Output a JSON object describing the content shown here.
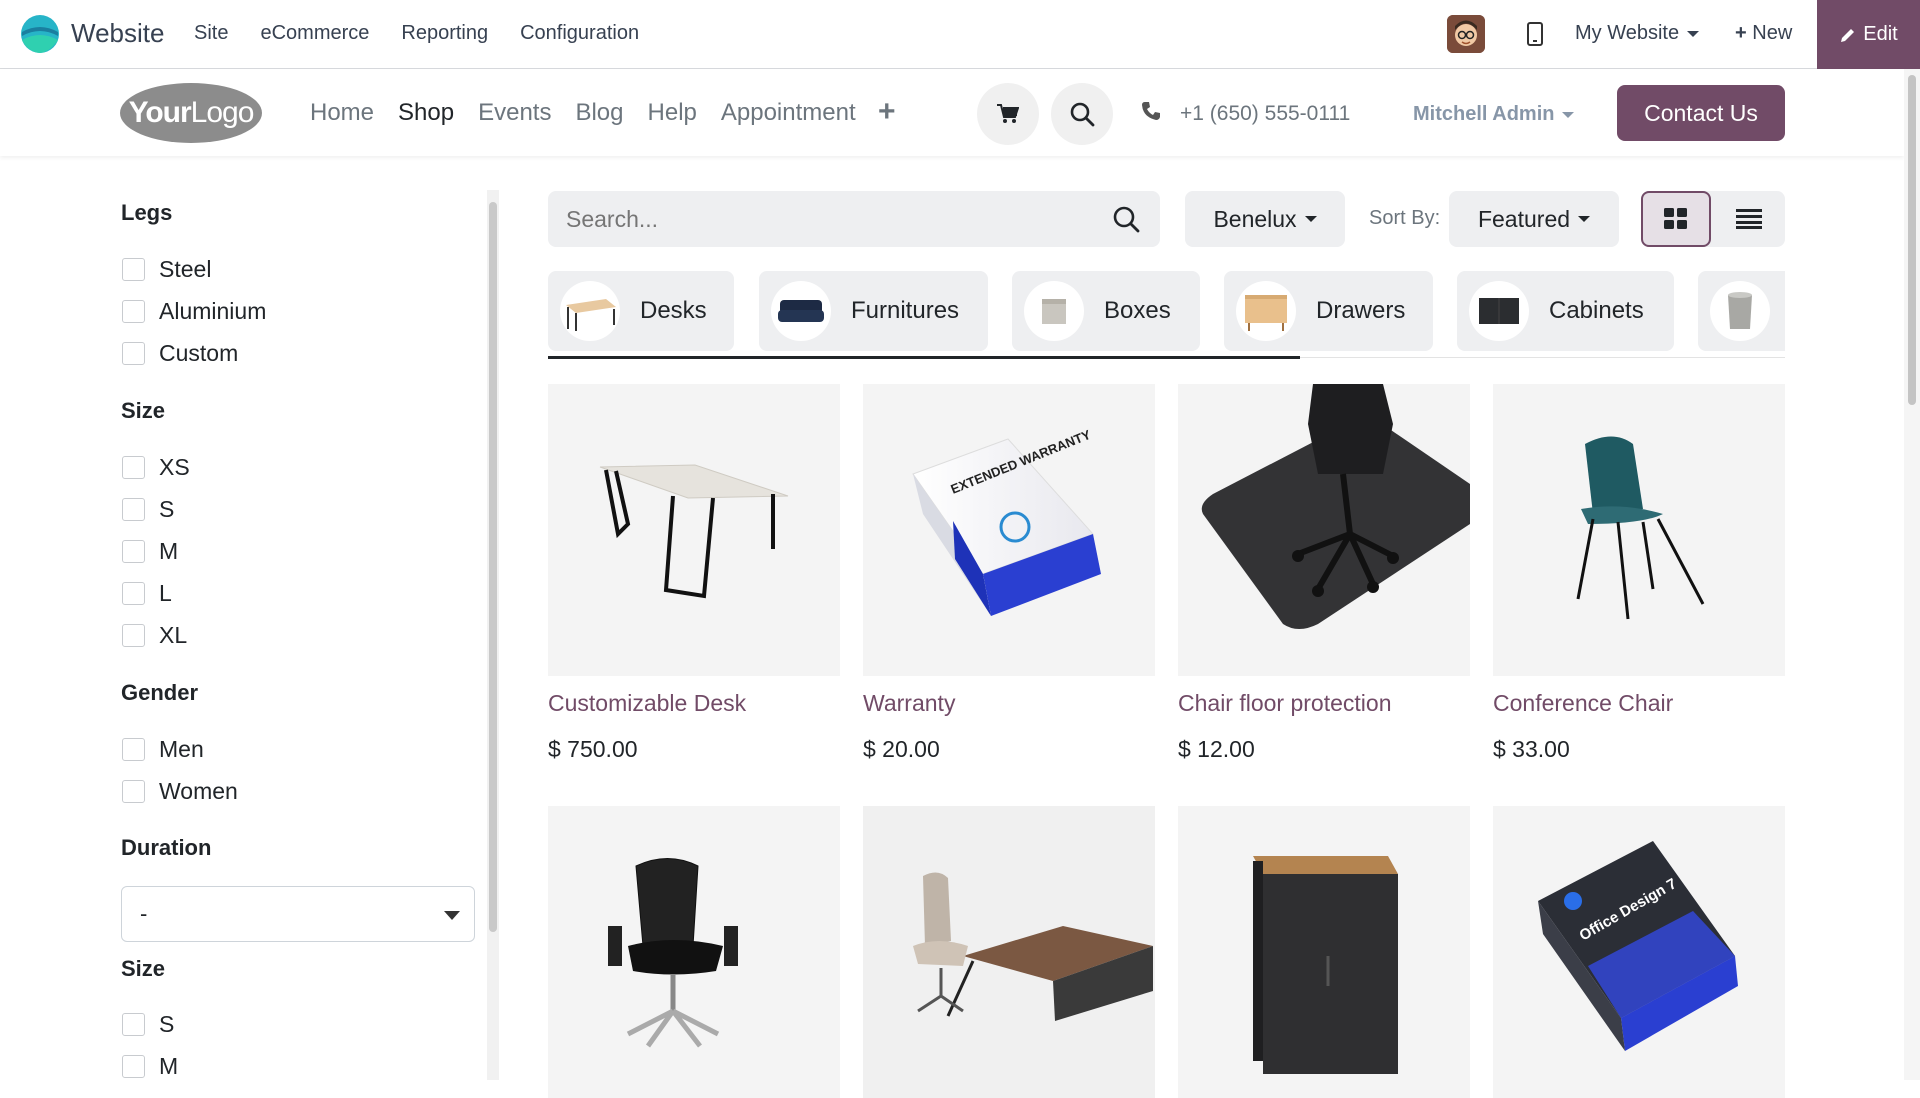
{
  "topbar": {
    "app_name": "Website",
    "menu": [
      "Site",
      "eCommerce",
      "Reporting",
      "Configuration"
    ],
    "website_selector": "My Website",
    "new_label": "New",
    "edit_label": "Edit"
  },
  "header": {
    "logo_bold": "Your",
    "logo_thin": "Logo",
    "nav": [
      "Home",
      "Shop",
      "Events",
      "Blog",
      "Help",
      "Appointment"
    ],
    "active_nav": "Shop",
    "phone": "+1 (650) 555-0111",
    "user": "Mitchell Admin",
    "contact_label": "Contact Us"
  },
  "sidebar": {
    "legs": {
      "title": "Legs",
      "options": [
        "Steel",
        "Aluminium",
        "Custom"
      ]
    },
    "size": {
      "title": "Size",
      "options": [
        "XS",
        "S",
        "M",
        "L",
        "XL"
      ]
    },
    "gender": {
      "title": "Gender",
      "options": [
        "Men",
        "Women"
      ]
    },
    "duration": {
      "title": "Duration",
      "selected": "-"
    },
    "size2": {
      "title": "Size",
      "options": [
        "S",
        "M"
      ]
    }
  },
  "toolbar": {
    "search_placeholder": "Search...",
    "pricelist": "Benelux",
    "sort_label": "Sort By:",
    "sort_value": "Featured"
  },
  "categories": [
    "Desks",
    "Furnitures",
    "Boxes",
    "Drawers",
    "Cabinets"
  ],
  "products": [
    {
      "name": "Customizable Desk",
      "price": "$ 750.00"
    },
    {
      "name": "Warranty",
      "price": "$ 20.00"
    },
    {
      "name": "Chair floor protection",
      "price": "$ 12.00"
    },
    {
      "name": "Conference Chair",
      "price": "$ 33.00"
    },
    {
      "name": "",
      "price": ""
    },
    {
      "name": "",
      "price": ""
    },
    {
      "name": "",
      "price": ""
    },
    {
      "name": "",
      "price": ""
    }
  ],
  "product_images": {
    "warranty_box_text": "EXTENDED WARRANTY",
    "office_design_box_text": "Office Design 7"
  },
  "colors": {
    "brand": "#714b67",
    "muted": "#6c757d",
    "chip": "#eeeff1"
  }
}
